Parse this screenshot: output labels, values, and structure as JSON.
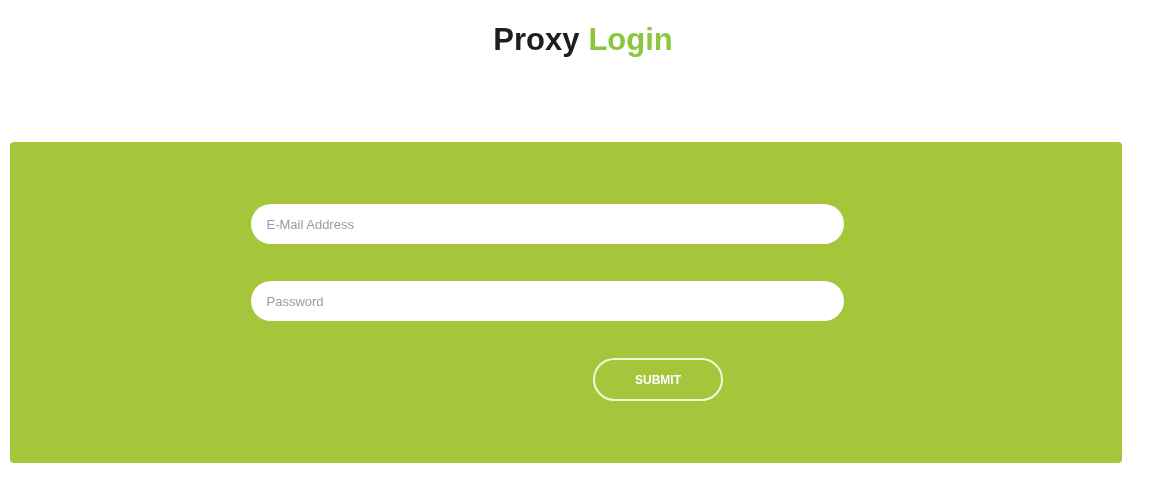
{
  "title": {
    "main": "Proxy",
    "accent": "Login"
  },
  "form": {
    "fields": [
      {
        "placeholder": "E-Mail Address"
      },
      {
        "placeholder": "Password"
      }
    ],
    "submit": "SUBMIT"
  }
}
